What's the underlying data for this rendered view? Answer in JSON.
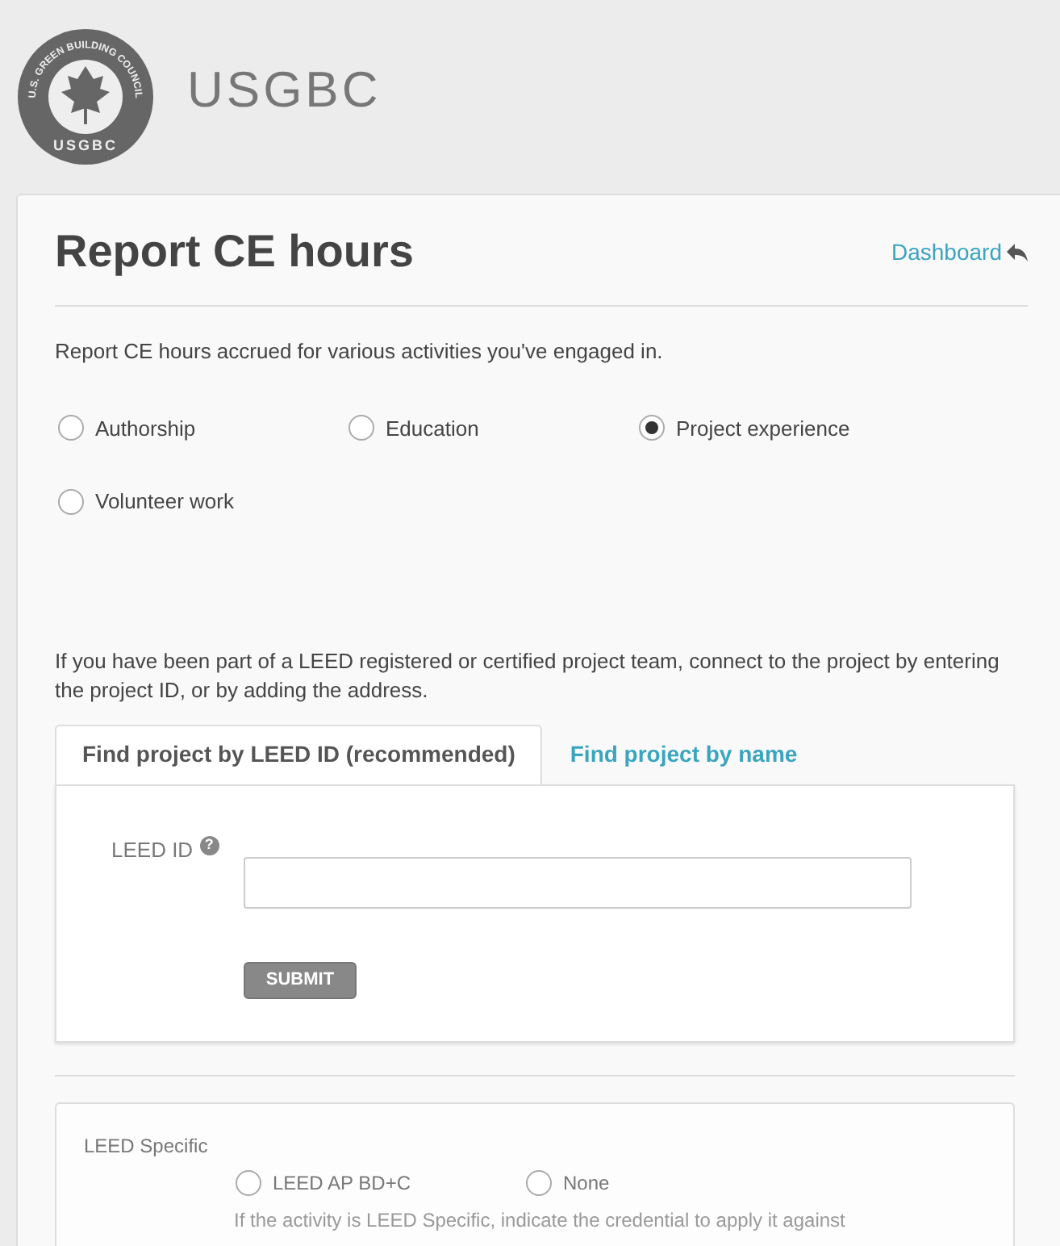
{
  "header": {
    "seal_ring_text": "U.S. GREEN BUILDING COUNCIL",
    "seal_bottom_text": "USGBC",
    "brand": "USGBC"
  },
  "page": {
    "title": "Report CE hours",
    "dashboard_link": "Dashboard",
    "intro": "Report CE hours accrued for various activities you've engaged in.",
    "activities": [
      {
        "label": "Authorship",
        "selected": false
      },
      {
        "label": "Education",
        "selected": false
      },
      {
        "label": "Project experience",
        "selected": true
      },
      {
        "label": "Volunteer work",
        "selected": false
      }
    ],
    "project_text": "If you have been part of a LEED registered or certified project team, connect to the project by entering the project ID, or by adding the address.",
    "tabs": [
      {
        "label": "Find project by LEED ID (recommended)",
        "selected": true
      },
      {
        "label": "Find project by name",
        "selected": false
      }
    ],
    "leed_id_label": "LEED ID",
    "help_mark": "?",
    "submit": "SUBMIT",
    "leed_specific": {
      "label": "LEED Specific",
      "options": [
        {
          "label": "LEED AP BD+C",
          "selected": false
        },
        {
          "label": "None",
          "selected": false
        }
      ],
      "hint": "If the activity is LEED Specific, indicate the credential to apply it against"
    }
  }
}
